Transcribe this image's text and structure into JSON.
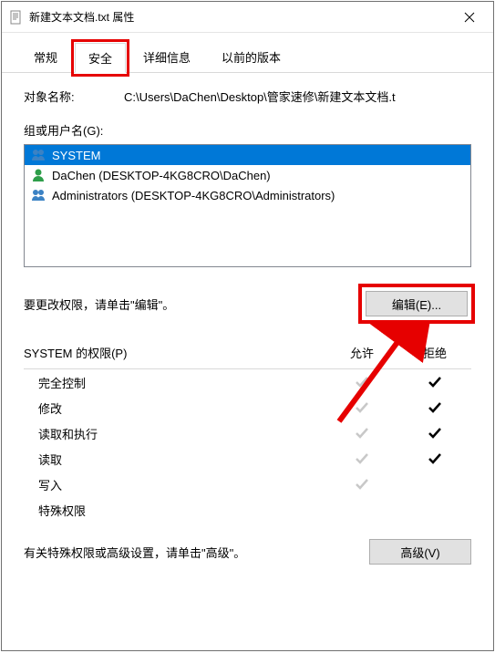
{
  "titlebar": {
    "title": "新建文本文档.txt 属性"
  },
  "tabs": {
    "general": "常规",
    "security": "安全",
    "details": "详细信息",
    "previous": "以前的版本",
    "active": "security"
  },
  "object": {
    "label": "对象名称:",
    "path": "C:\\Users\\DaChen\\Desktop\\管家速修\\新建文本文档.t"
  },
  "groupLabel": "组或用户名(G):",
  "users": [
    {
      "name": "SYSTEM",
      "iconKind": "group",
      "selected": true
    },
    {
      "name": "DaChen (DESKTOP-4KG8CRO\\DaChen)",
      "iconKind": "user",
      "selected": false
    },
    {
      "name": "Administrators (DESKTOP-4KG8CRO\\Administrators)",
      "iconKind": "group",
      "selected": false
    }
  ],
  "editHint": "要更改权限，请单击\"编辑\"。",
  "editButton": "编辑(E)...",
  "permHeader": {
    "subject": "SYSTEM 的权限(P)",
    "allow": "允许",
    "deny": "拒绝"
  },
  "permissions": [
    {
      "name": "完全控制",
      "allow": "gray",
      "deny": "black"
    },
    {
      "name": "修改",
      "allow": "gray",
      "deny": "black"
    },
    {
      "name": "读取和执行",
      "allow": "gray",
      "deny": "black"
    },
    {
      "name": "读取",
      "allow": "gray",
      "deny": "black"
    },
    {
      "name": "写入",
      "allow": "gray",
      "deny": "none"
    },
    {
      "name": "特殊权限",
      "allow": "none",
      "deny": "none"
    }
  ],
  "advancedHint": "有关特殊权限或高级设置，请单击\"高级\"。",
  "advancedButton": "高级(V)"
}
